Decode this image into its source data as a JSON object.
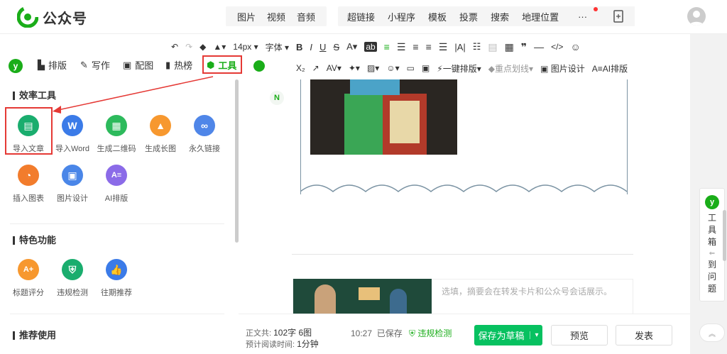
{
  "app": {
    "name": "公众号"
  },
  "media_menu": [
    "图片",
    "视频",
    "音频"
  ],
  "insert_menu": [
    "超链接",
    "小程序",
    "模板",
    "投票",
    "搜索",
    "地理位置"
  ],
  "more_label": "···",
  "format_row1": {
    "font_size": "14px",
    "font": "字体"
  },
  "format_row2": {
    "one_key": "一键排版",
    "highlight": "重点划线",
    "image_design": "图片设计",
    "ai_layout": "AI排版"
  },
  "plugin_tabs": [
    "排版",
    "写作",
    "配图",
    "热榜",
    "工具"
  ],
  "left": {
    "section1": "效率工具",
    "tools1": [
      {
        "label": "导入文章",
        "color": "#1aad6e"
      },
      {
        "label": "导入Word",
        "color": "#3b7be8"
      },
      {
        "label": "生成二维码",
        "color": "#2dba5c"
      },
      {
        "label": "生成长图",
        "color": "#f7982f"
      },
      {
        "label": "永久链接",
        "color": "#4f86e8"
      },
      {
        "label": "插入图表",
        "color": "#f27c2c"
      },
      {
        "label": "图片设计",
        "color": "#4a86e8"
      },
      {
        "label": "AI排版",
        "color": "#8b6be8"
      }
    ],
    "section2": "特色功能",
    "tools2": [
      {
        "label": "标题评分",
        "color": "#f7982f"
      },
      {
        "label": "违规检测",
        "color": "#1aad6e"
      },
      {
        "label": "往期推荐",
        "color": "#3b7be8"
      }
    ],
    "section3": "推荐使用"
  },
  "editor": {
    "summary_placeholder": "选填，摘要会在转发卡片和公众号会话展示。"
  },
  "footer": {
    "word_label": "正文共:",
    "word_count": "102字 6图",
    "read_label": "预计阅读时间:",
    "read_time": "1分钟",
    "saved_time": "10:27",
    "saved_text": "已保存",
    "check_label": "违规检测",
    "save_draft": "保存为草稿",
    "preview": "预览",
    "publish": "发表"
  },
  "right_panel": {
    "toolbox_chars": [
      "工",
      "具",
      "箱"
    ],
    "issue_chars": [
      "到",
      "问",
      "题"
    ]
  },
  "colors": {
    "green": "#1aad19",
    "red": "#e53935"
  }
}
